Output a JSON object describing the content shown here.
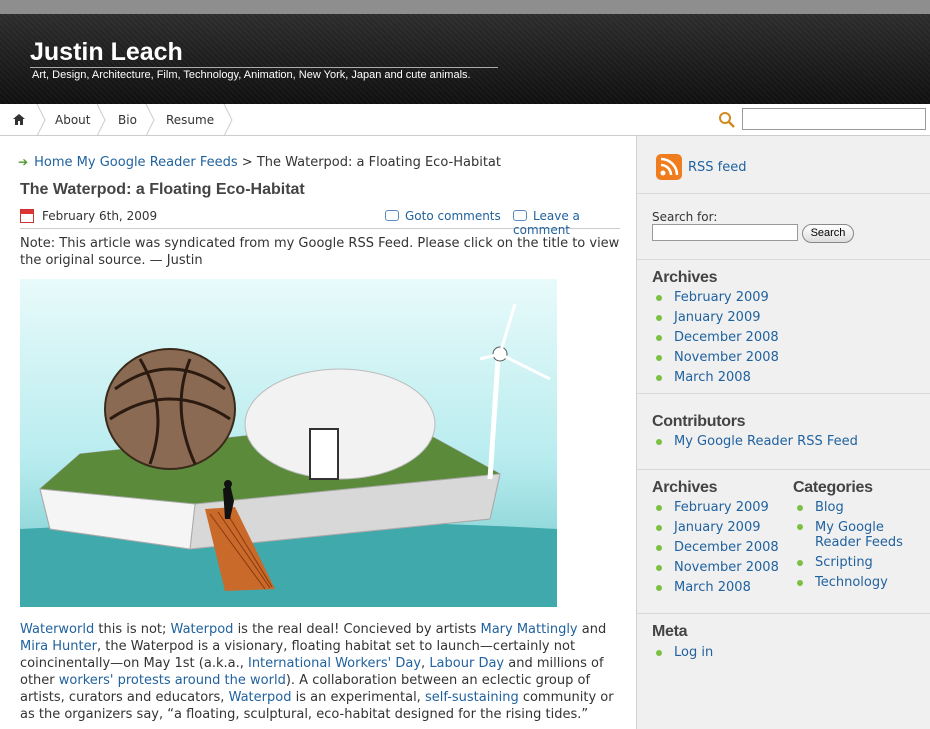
{
  "site": {
    "title": "Justin Leach",
    "tagline": "Art, Design, Architecture, Film, Technology, Animation, New York, Japan and cute animals."
  },
  "nav": {
    "items": [
      "About",
      "Bio",
      "Resume"
    ]
  },
  "breadcrumb": {
    "home": "Home",
    "category": "My Google Reader Feeds",
    "separator": ">",
    "current": "The Waterpod: a Floating Eco-Habitat"
  },
  "post": {
    "title": "The Waterpod: a Floating Eco-Habitat",
    "date": "February 6th, 2009",
    "goto_comments": "Goto comments",
    "leave_comment": "Leave a comment",
    "note": "Note: This article was syndicated from my Google RSS Feed. Please click on the title to view the original source. — Justin",
    "body": {
      "p1": "Waterworld",
      "p2": " this is not; ",
      "p3": "Waterpod",
      "p4": " is the real deal! Concieved by artists ",
      "p5": "Mary Mattingly",
      "p6": " and ",
      "p7": "Mira Hunter",
      "p8": ", the Waterpod is a visionary, floating habitat set to launch—certainly not coincinentally—on May 1st (a.k.a., ",
      "p9": "International Workers' Day",
      "p10": ", ",
      "p11": "Labour Day",
      "p12": " and millions of other ",
      "p13": "workers' protests around the world",
      "p14": "). A collaboration between an eclectic group of artists, curators and educators, ",
      "p15": "Waterpod",
      "p16": " is an experimental, ",
      "p17": "self-sustaining",
      "p18": " community or as the organizers say, “a floating, sculptural, eco-habitat designed for the rising tides.”"
    }
  },
  "sidebar": {
    "rss_label": "RSS feed",
    "search_label": "Search for:",
    "search_button": "Search",
    "archives1": {
      "heading": "Archives",
      "items": [
        "February 2009",
        "January 2009",
        "December 2008",
        "November 2008",
        "March 2008"
      ]
    },
    "contributors": {
      "heading": "Contributors",
      "items": [
        "My Google Reader RSS Feed"
      ]
    },
    "archives2": {
      "heading": "Archives",
      "items": [
        "February 2009",
        "January 2009",
        "December 2008",
        "November 2008",
        "March 2008"
      ]
    },
    "categories": {
      "heading": "Categories",
      "items": [
        "Blog",
        "My Google Reader Feeds",
        "Scripting",
        "Technology"
      ]
    },
    "meta": {
      "heading": "Meta",
      "items": [
        "Log in"
      ]
    }
  },
  "colors": {
    "link": "#21629e",
    "header_bg": "#151515",
    "sidebar_bg": "#f0f0f0",
    "bullet": "#7bc043",
    "rss": "#f07d1d"
  }
}
